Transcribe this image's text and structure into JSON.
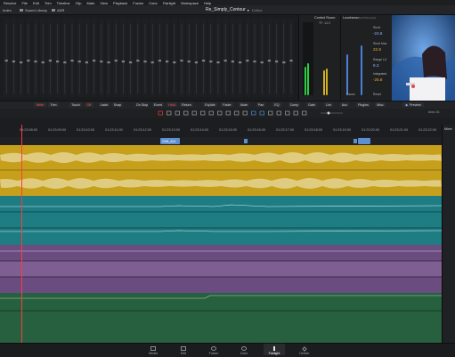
{
  "menubar": {
    "items": [
      "Resolve",
      "File",
      "Edit",
      "Trim",
      "Timeline",
      "Clip",
      "Mark",
      "View",
      "Playback",
      "Fusion",
      "Color",
      "Fairlight",
      "Workspace",
      "Help"
    ]
  },
  "toolbar": {
    "index_label": "Index",
    "sound_library_label": "Sound Library",
    "adr_label": "ADR",
    "project_title": "Re_Simply_Contour",
    "edited_label": "Edited"
  },
  "meters": {
    "control_room_label": "Control Room",
    "control_room_sub": "TP -14.0",
    "loudness_label": "Loudness",
    "loudness_sub": "BS.1770-1 (LU)",
    "short_label": "Short",
    "short_value": "-24.6",
    "short_max_label": "Short Max",
    "short_max_value": "22.8",
    "range_label": "Range LU",
    "range_value": "8.3",
    "integrated_label": "Integrated",
    "integrated_value": "-25.8",
    "pause_label": "Pause",
    "reset_label": "Reset"
  },
  "automation": {
    "chips": [
      "Write",
      "Trim",
      "Touch",
      "Off",
      "Latch",
      "Snap",
      "On Stop",
      "Event",
      "Hold",
      "Return",
      "Eq/Idle",
      "Fader",
      "Mute",
      "Pan",
      "EQ",
      "Comp",
      "Gate",
      "Lim",
      "Aux",
      "Plugins",
      "Misc"
    ],
    "preview_label": "Preview",
    "area_label": "Area 1/1"
  },
  "timeline": {
    "timecodes": [
      "01:23:08:00",
      "01:23:09:00",
      "01:23:10:00",
      "01:23:11:00",
      "01:23:12:00",
      "01:23:13:00",
      "01:23:14:00",
      "01:23:15:00",
      "01:23:16:00",
      "01:23:17:00",
      "01:23:18:00",
      "01:23:19:00",
      "01:23:20:00",
      "01:23:21:00",
      "01:23:22:00"
    ],
    "marker_clip_label": "GHB_A04"
  },
  "right_panel": {
    "title": "Mixer"
  },
  "pages": {
    "items": [
      "Media",
      "Edit",
      "Fusion",
      "Color",
      "Fairlight",
      "Deliver"
    ]
  },
  "colors": {
    "gold_track": "#c8a21e",
    "teal_track": "#1f7f86",
    "purple_track": "#6e4f82",
    "green_track": "#2b6a48",
    "accent_red": "#e23b3b"
  }
}
